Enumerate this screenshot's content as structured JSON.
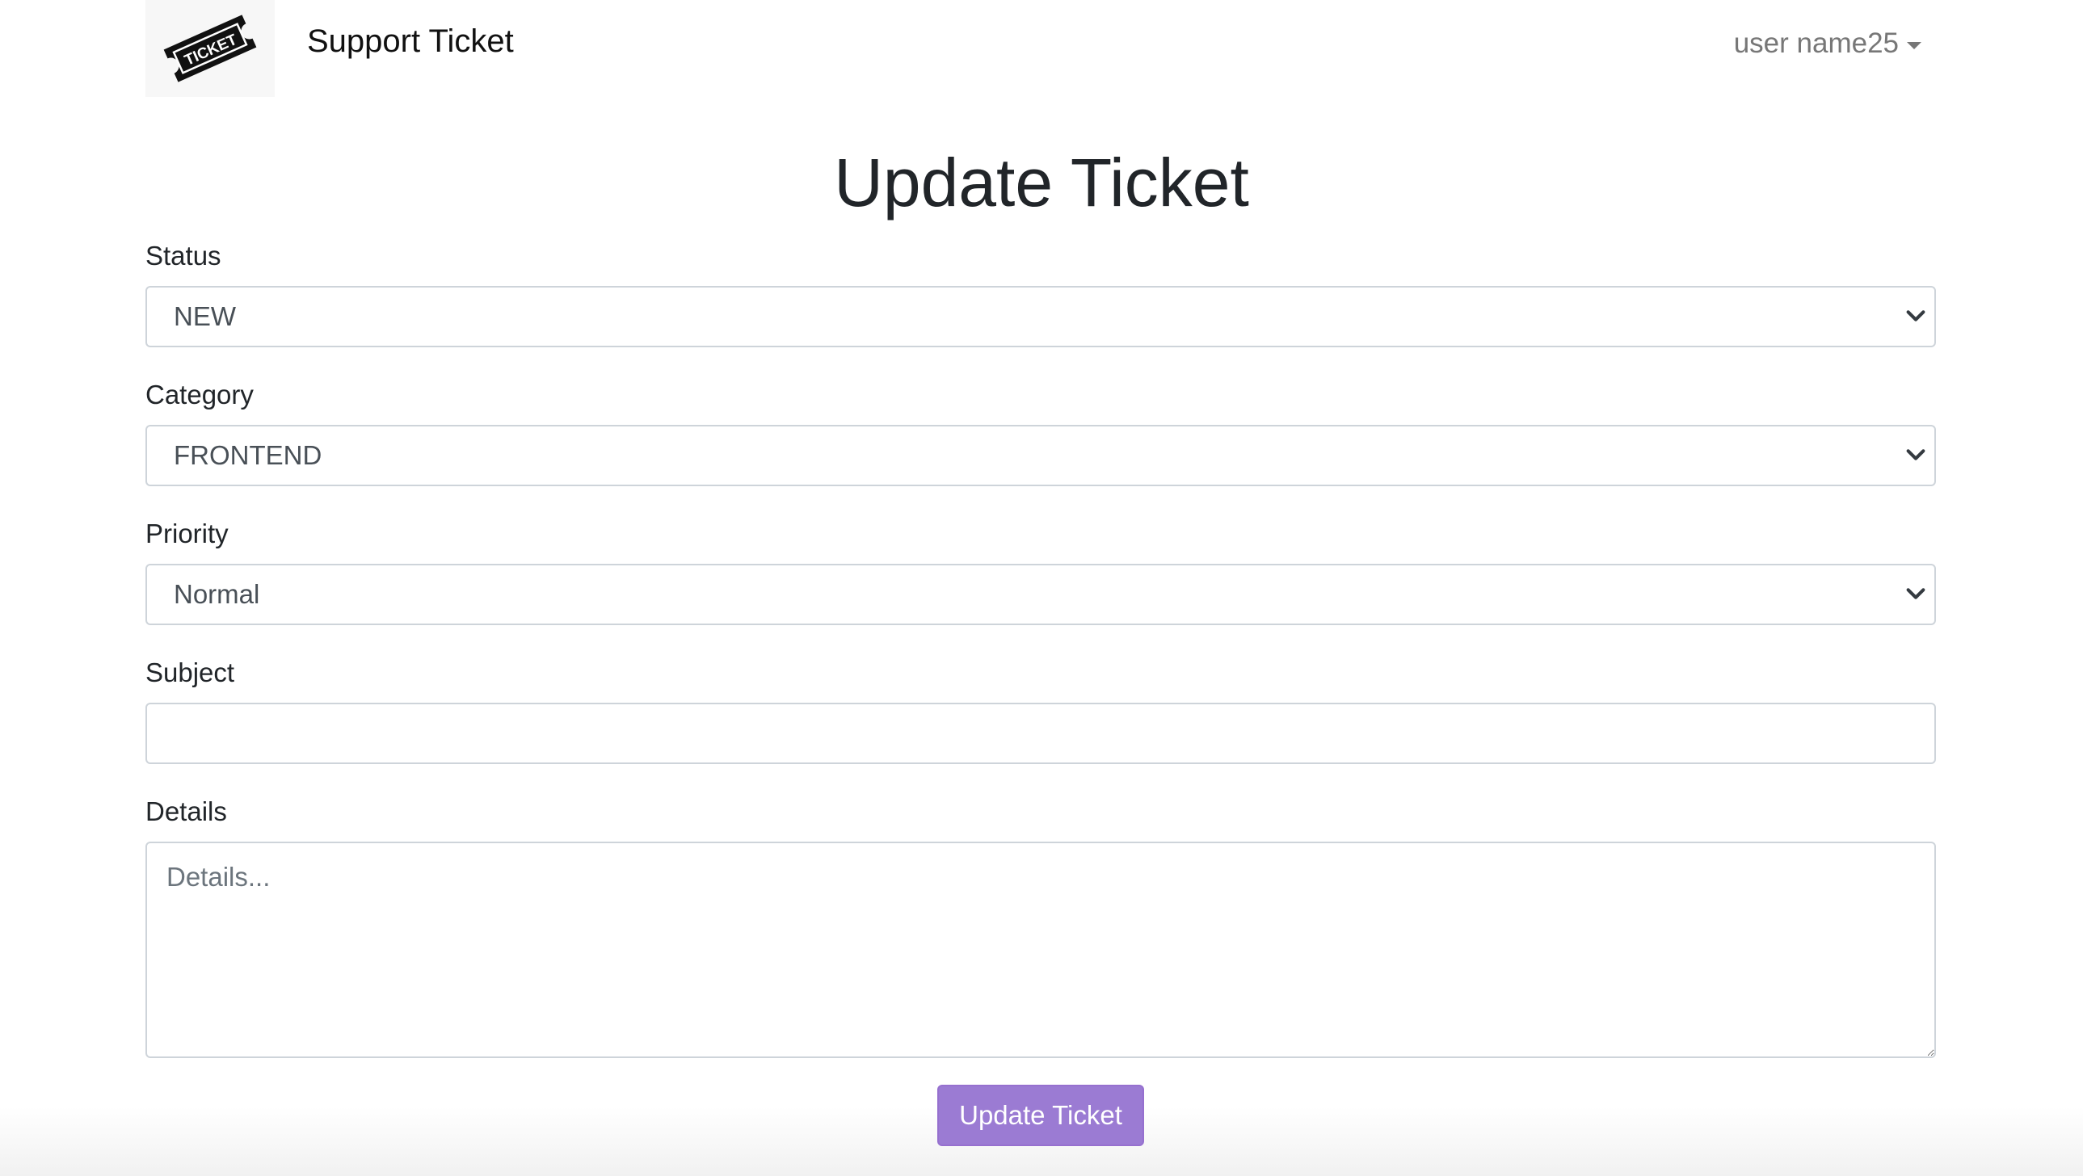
{
  "navbar": {
    "brand_title": "Support Ticket",
    "logo_icon": "ticket-logo-icon",
    "logo_text": "TICKET",
    "user_menu_label": "user name25",
    "user_menu_icon": "caret-down-icon"
  },
  "page_title": "Update Ticket",
  "form": {
    "status": {
      "label": "Status",
      "value": "NEW",
      "icon": "chevron-down-icon"
    },
    "category": {
      "label": "Category",
      "value": "FRONTEND",
      "icon": "chevron-down-icon"
    },
    "priority": {
      "label": "Priority",
      "value": "Normal",
      "icon": "chevron-down-icon"
    },
    "subject": {
      "label": "Subject",
      "value": "",
      "placeholder": ""
    },
    "details": {
      "label": "Details",
      "value": "",
      "placeholder": "Details..."
    },
    "submit_label": "Update Ticket"
  },
  "colors": {
    "primary_button": "#9b7bd3",
    "text": "#212529",
    "muted": "#777777",
    "border": "#ced4da"
  }
}
